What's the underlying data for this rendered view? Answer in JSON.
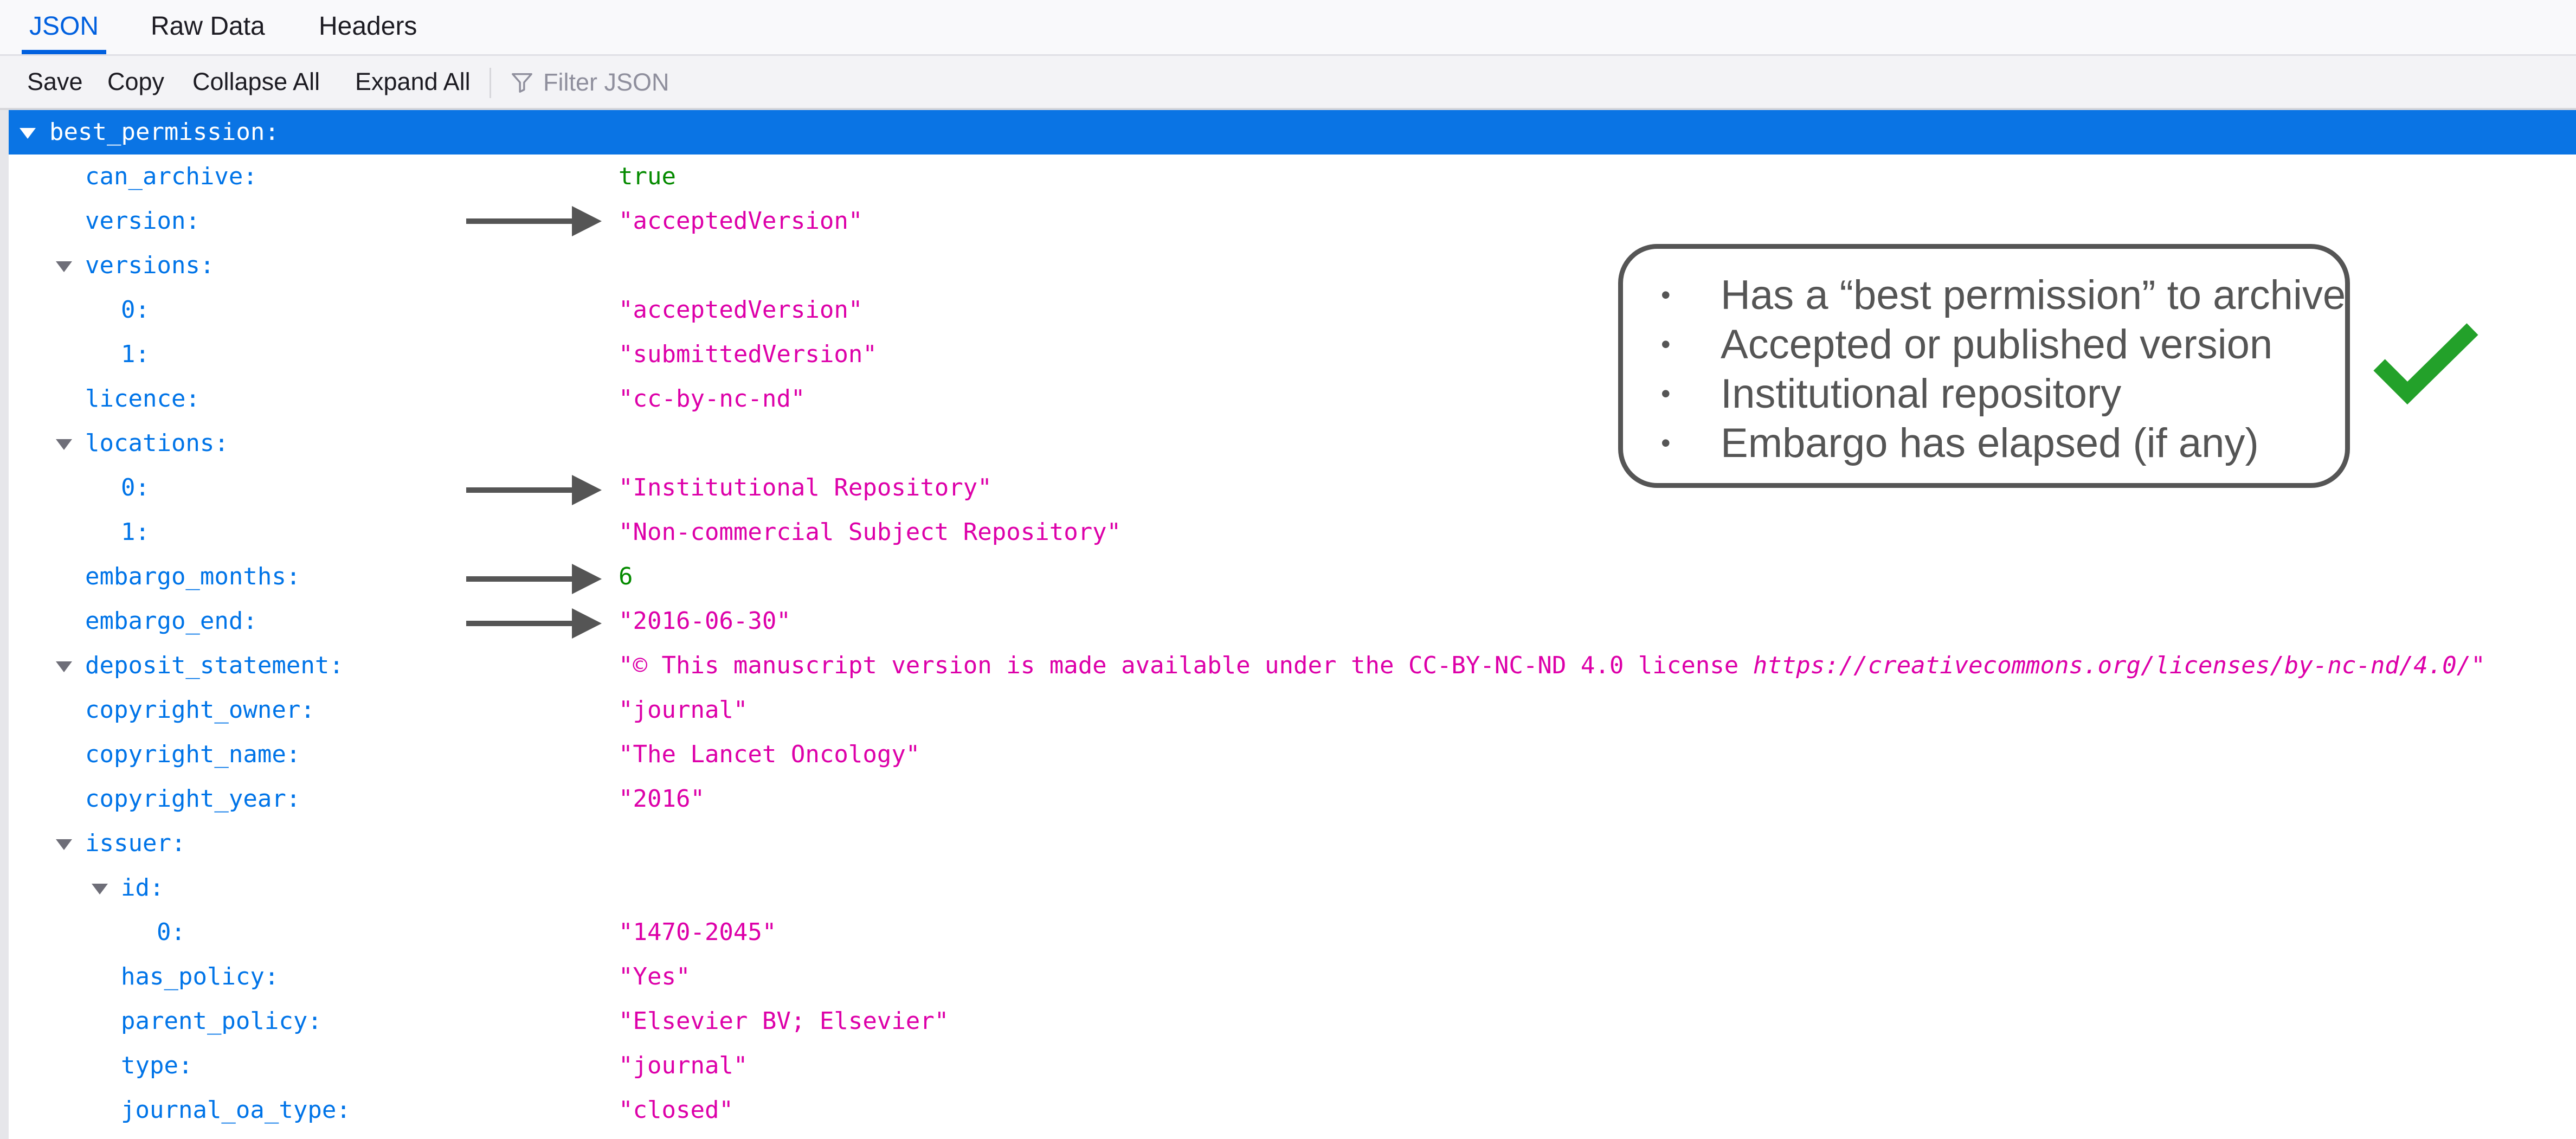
{
  "tabs": [
    {
      "label": "JSON",
      "active": true
    },
    {
      "label": "Raw Data",
      "active": false
    },
    {
      "label": "Headers",
      "active": false
    }
  ],
  "toolbar": {
    "save_label": "Save",
    "copy_label": "Copy",
    "collapse_label": "Collapse All",
    "expand_label": "Expand All",
    "filter_placeholder": "Filter JSON"
  },
  "tree": {
    "best_permission": "best_permission:",
    "can_archive": {
      "key": "can_archive:",
      "value": "true"
    },
    "version": {
      "key": "version:",
      "value": "\"acceptedVersion\""
    },
    "versions": {
      "key": "versions:",
      "items": [
        {
          "key": "0:",
          "value": "\"acceptedVersion\""
        },
        {
          "key": "1:",
          "value": "\"submittedVersion\""
        }
      ]
    },
    "licence": {
      "key": "licence:",
      "value": "\"cc-by-nc-nd\""
    },
    "locations": {
      "key": "locations:",
      "items": [
        {
          "key": "0:",
          "value": "\"Institutional Repository\""
        },
        {
          "key": "1:",
          "value": "\"Non-commercial Subject Repository\""
        }
      ]
    },
    "embargo_months": {
      "key": "embargo_months:",
      "value": "6"
    },
    "embargo_end": {
      "key": "embargo_end:",
      "value": "\"2016-06-30\""
    },
    "deposit_statement": {
      "key": "deposit_statement:",
      "value_text": "\"© This manuscript version is made available under the CC-BY-NC-ND 4.0 license ",
      "value_url": "https://creativecommons.org/licenses/by-nc-nd/4.0/",
      "value_close": "\""
    },
    "copyright_owner": {
      "key": "copyright_owner:",
      "value": "\"journal\""
    },
    "copyright_name": {
      "key": "copyright_name:",
      "value": "\"The Lancet Oncology\""
    },
    "copyright_year": {
      "key": "copyright_year:",
      "value": "\"2016\""
    },
    "issuer": {
      "key": "issuer:",
      "id": {
        "key": "id:",
        "items": [
          {
            "key": "0:",
            "value": "\"1470-2045\""
          }
        ]
      },
      "has_policy": {
        "key": "has_policy:",
        "value": "\"Yes\""
      },
      "parent_policy": {
        "key": "parent_policy:",
        "value": "\"Elsevier BV; Elsevier\""
      },
      "type": {
        "key": "type:",
        "value": "\"journal\""
      },
      "journal_oa_type": {
        "key": "journal_oa_type:",
        "value": "\"closed\""
      }
    }
  },
  "callout": {
    "items": [
      "Has a “best permission” to archive",
      "Accepted or published version",
      "Institutional repository",
      "Embargo has elapsed (if any)"
    ]
  },
  "icons": {
    "filter": "filter-icon",
    "twisty": "chevron-down-icon",
    "arrow": "arrow-right-icon",
    "check": "checkmark-icon"
  },
  "colors": {
    "accent": "#0060df",
    "selected_row": "#0a74e4",
    "key": "#0074e8",
    "string": "#dd00a9",
    "number_bool": "#058b00",
    "check": "#23a12a",
    "annotation": "#555555"
  }
}
